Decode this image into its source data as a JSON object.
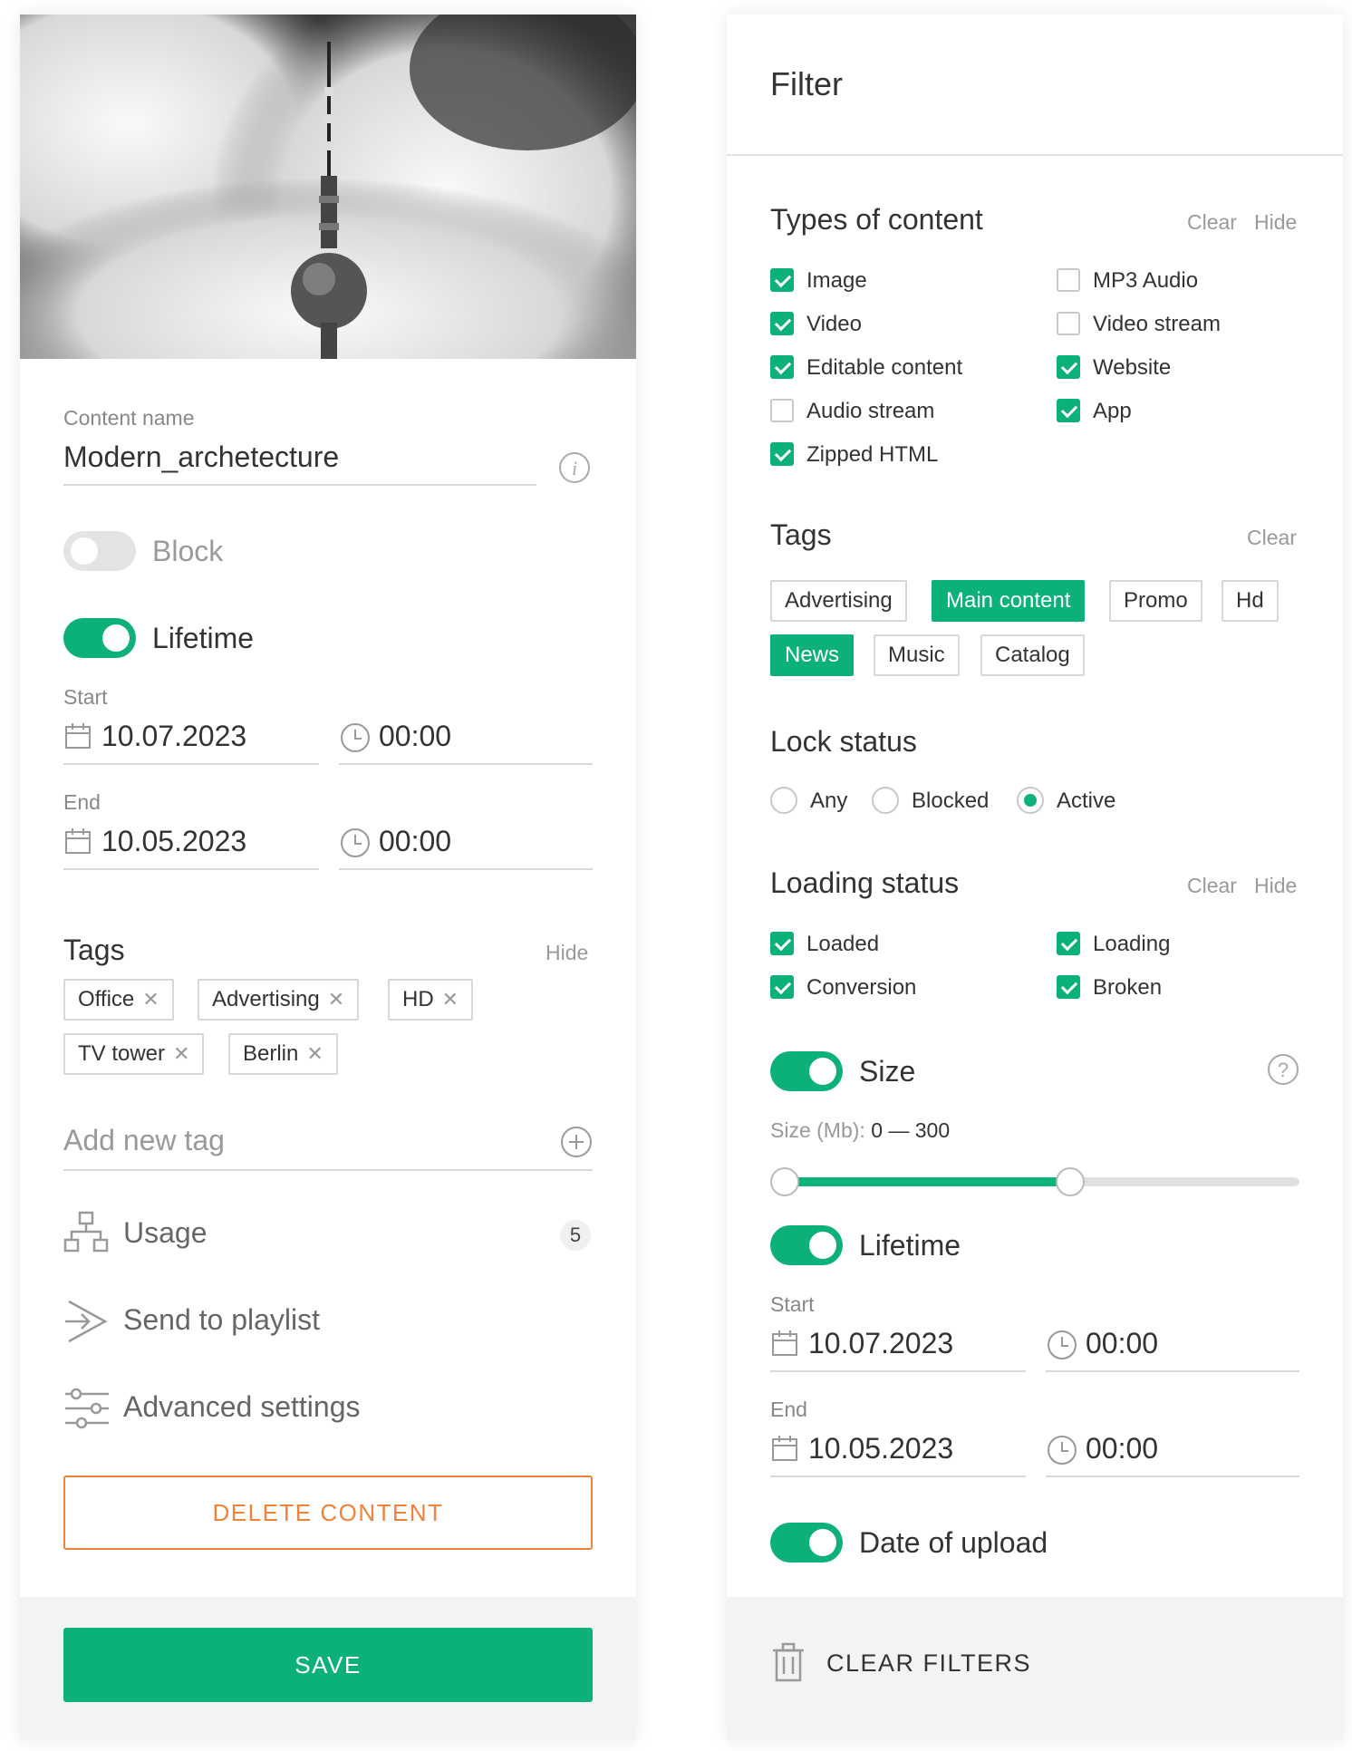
{
  "content_card": {
    "content_name_label": "Content name",
    "content_name_value": "Modern_archetecture",
    "block_label": "Block",
    "lifetime_label": "Lifetime",
    "start_label": "Start",
    "start_date": "10.07.2023",
    "start_time": "00:00",
    "end_label": "End",
    "end_date": "10.05.2023",
    "end_time": "00:00",
    "tags_title": "Tags",
    "tags_hide": "Hide",
    "tags": [
      "Office",
      "Advertising",
      "HD",
      "TV tower",
      "Berlin"
    ],
    "add_tag_placeholder": "Add new tag",
    "usage_label": "Usage",
    "usage_count": "5",
    "send_label": "Send to playlist",
    "advanced_label": "Advanced settings",
    "delete_label": "DELETE CONTENT",
    "save_label": "SAVE",
    "block_on": false,
    "lifetime_on": true
  },
  "filter": {
    "title": "Filter",
    "types_title": "Types of content",
    "clear": "Clear",
    "hide": "Hide",
    "types": [
      {
        "label": "Image",
        "checked": true
      },
      {
        "label": "Video",
        "checked": true
      },
      {
        "label": "Editable content",
        "checked": true
      },
      {
        "label": "Audio stream",
        "checked": false
      },
      {
        "label": "Zipped HTML",
        "checked": true
      },
      {
        "label": "MP3 Audio",
        "checked": false
      },
      {
        "label": "Video stream",
        "checked": false
      },
      {
        "label": "Website",
        "checked": true
      },
      {
        "label": "App",
        "checked": true
      }
    ],
    "tags_title": "Tags",
    "tags": [
      {
        "label": "Advertising",
        "selected": false
      },
      {
        "label": "Main content",
        "selected": true
      },
      {
        "label": "Promo",
        "selected": false
      },
      {
        "label": "Hd",
        "selected": false
      },
      {
        "label": "News",
        "selected": true
      },
      {
        "label": "Music",
        "selected": false
      },
      {
        "label": "Catalog",
        "selected": false
      }
    ],
    "lock_title": "Lock status",
    "lock_options": [
      "Any",
      "Blocked",
      "Active"
    ],
    "lock_selected": "Active",
    "loading_title": "Loading status",
    "loading": [
      {
        "label": "Loaded",
        "checked": true
      },
      {
        "label": "Conversion",
        "checked": true
      },
      {
        "label": "Loading",
        "checked": true
      },
      {
        "label": "Broken",
        "checked": true
      }
    ],
    "size_label": "Size",
    "size_range_label": "Size (Mb):",
    "size_range_value": "0 — 300",
    "size_slider": {
      "min_fraction": 0.0,
      "max_fraction": 0.57
    },
    "lifetime_label": "Lifetime",
    "start_label": "Start",
    "start_date": "10.07.2023",
    "start_time": "00:00",
    "end_label": "End",
    "end_date": "10.05.2023",
    "end_time": "00:00",
    "upload_label": "Date of upload",
    "clear_filters_label": "CLEAR FILTERS",
    "size_on": true,
    "lifetime_on": true,
    "upload_on": true
  },
  "colors": {
    "accent": "#0bb07b",
    "danger": "#f0823a"
  }
}
